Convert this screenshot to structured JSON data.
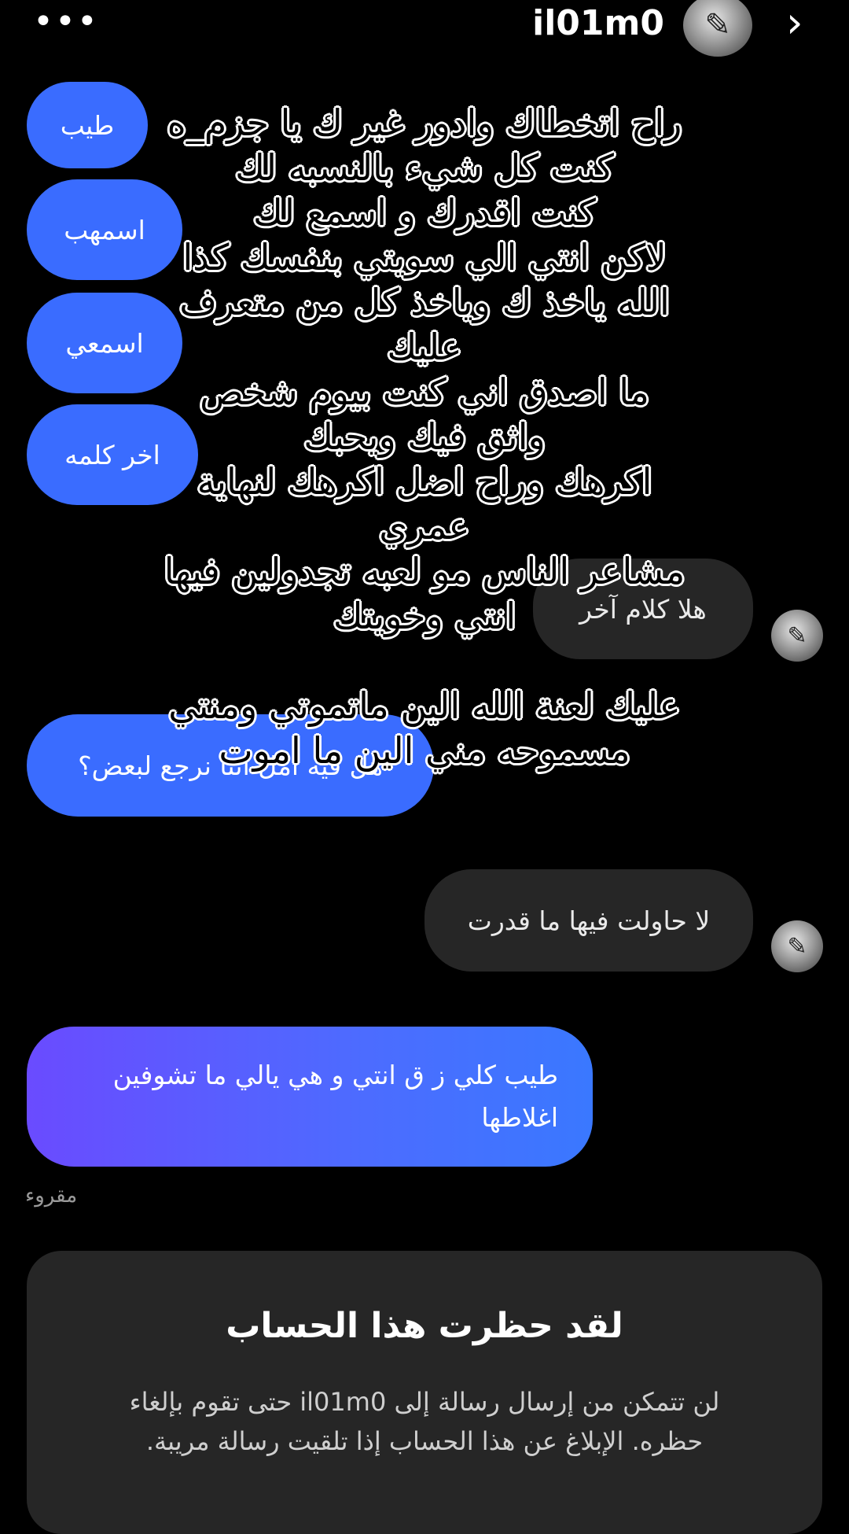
{
  "header": {
    "more_icon": "•••",
    "username": "il01m0",
    "avatar_glyph": "✎",
    "back_icon": "›"
  },
  "messages": {
    "m1": "طيب",
    "m2": "اسمهب",
    "m3": "اسمعي",
    "m4": "اخر كلمه",
    "m5": "هلا كلام آخر",
    "m6": "هل فيه امل اننا نرجع لبعض؟",
    "m7": "لا حاولت فيها ما قدرت",
    "m8": "طيب كلي ز ق انتي و هي يالي ما تشوفين اغلاطها"
  },
  "overlay_text": [
    "راح اتخطاك وادور غير ك يا جزم_ه",
    "كنت كل شيء بالنسبه لك",
    "كنت اقدرك و اسمع لك",
    "لاكن انتي الي سويتي بنفسك كذا",
    "الله ياخذ ك وياخذ كل من متعرف",
    "عليك",
    "ما اصدق اني كنت بيوم شخص",
    "واثق فيك ويحبك",
    "اكرهك وراح اضل اكرهك لنهاية",
    "عمري",
    "مشاعر الناس مو لعبه تجدولين فيها",
    "انتي وخويتك",
    "",
    "عليك لعنة الله الين ماتموتي ومنتي",
    "مسموحه مني الين ما اموت"
  ],
  "seen_label": "مقروء",
  "block": {
    "title": "لقد حظرت هذا الحساب",
    "description": "لن تتمكن من إرسال رسالة إلى il01m0 حتى تقوم بإلغاء حظره. الإبلاغ عن هذا الحساب إذا تلقيت رسالة مريبة."
  }
}
